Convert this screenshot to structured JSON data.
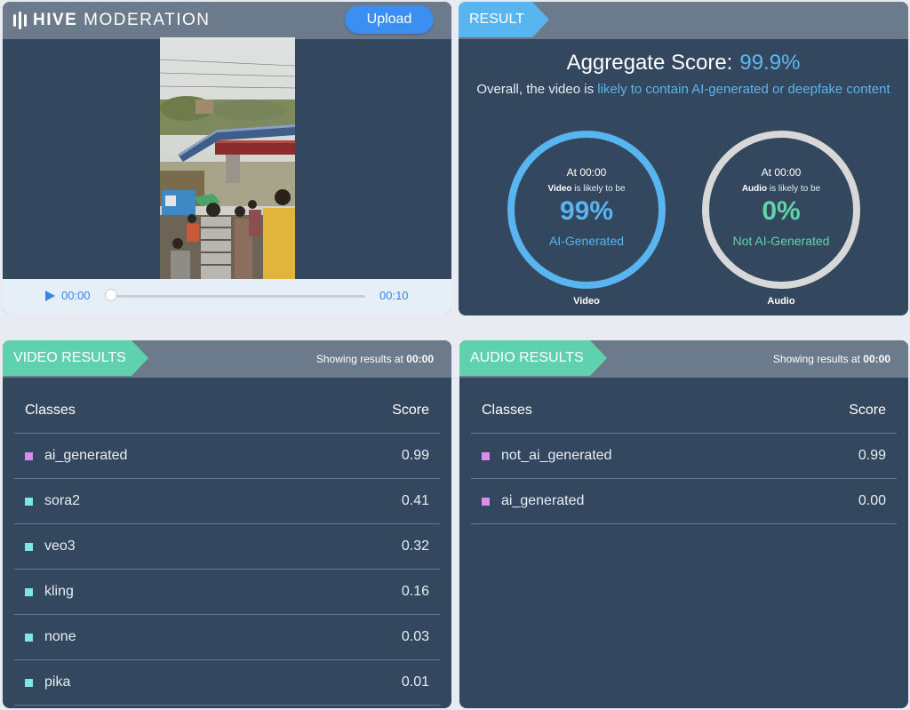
{
  "header": {
    "logo_bold": "HIVE",
    "logo_rest": "MODERATION",
    "upload_label": "Upload"
  },
  "player": {
    "current_time": "00:00",
    "duration": "00:10",
    "progress": 0
  },
  "result": {
    "tag": "RESULT",
    "aggregate_label": "Aggregate Score:",
    "aggregate_value": "99.9%",
    "overall_prefix": "Overall, the video is",
    "overall_highlight": "likely to contain AI-generated or deepfake content",
    "video_ring": {
      "at": "At 00:00",
      "subject": "Video",
      "likely": "is likely to be",
      "percent": "99%",
      "class": "AI-Generated",
      "label": "Video",
      "color": "#58b5ef"
    },
    "audio_ring": {
      "at": "At 00:00",
      "subject": "Audio",
      "likely": "is likely to be",
      "percent": "0%",
      "class": "Not AI-Generated",
      "label": "Audio",
      "color": "#62d3a8"
    }
  },
  "video_results": {
    "tag": "VIDEO RESULTS",
    "showing_prefix": "Showing results at",
    "showing_time": "00:00",
    "col_classes": "Classes",
    "col_score": "Score",
    "rows": [
      {
        "name": "ai_generated",
        "score": "0.99",
        "color": "#d98bf0"
      },
      {
        "name": "sora2",
        "score": "0.41",
        "color": "#7ee6e6"
      },
      {
        "name": "veo3",
        "score": "0.32",
        "color": "#7ee6e6"
      },
      {
        "name": "kling",
        "score": "0.16",
        "color": "#7ee6e6"
      },
      {
        "name": "none",
        "score": "0.03",
        "color": "#7ee6e6"
      },
      {
        "name": "pika",
        "score": "0.01",
        "color": "#7ee6e6"
      }
    ]
  },
  "audio_results": {
    "tag": "AUDIO RESULTS",
    "showing_prefix": "Showing results at",
    "showing_time": "00:00",
    "col_classes": "Classes",
    "col_score": "Score",
    "rows": [
      {
        "name": "not_ai_generated",
        "score": "0.99",
        "color": "#d98bf0"
      },
      {
        "name": "ai_generated",
        "score": "0.00",
        "color": "#d98bf0"
      }
    ]
  }
}
